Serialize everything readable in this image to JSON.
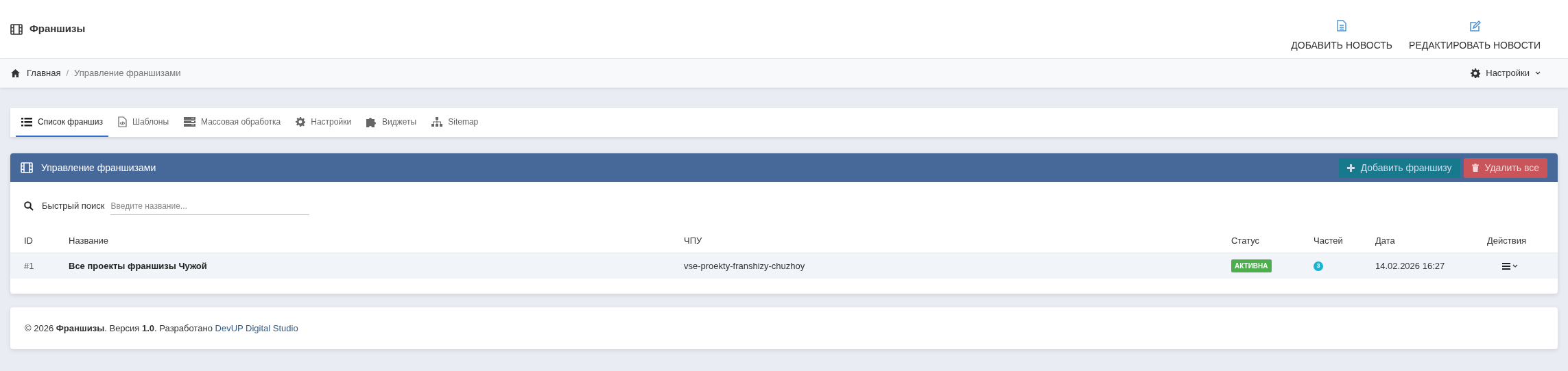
{
  "header": {
    "title": "Франшизы",
    "actions": [
      {
        "label": "ДОБАВИТЬ НОВОСТЬ",
        "kind": "add"
      },
      {
        "label": "РЕДАКТИРОВАТЬ НОВОСТИ",
        "kind": "edit"
      }
    ]
  },
  "breadcrumb": {
    "items": [
      "Главная",
      "Управление франшизами"
    ],
    "separator": "/",
    "settings": "Настройки"
  },
  "tabs": [
    {
      "label": "Список франшиз",
      "kind": "list",
      "selected": true
    },
    {
      "label": "Шаблоны",
      "kind": "template",
      "selected": false
    },
    {
      "label": "Массовая обработка",
      "kind": "mass",
      "selected": false
    },
    {
      "label": "Настройки",
      "kind": "gear",
      "selected": false
    },
    {
      "label": "Виджеты",
      "kind": "puzzle",
      "selected": false
    },
    {
      "label": "Sitemap",
      "kind": "sitemap",
      "selected": false
    }
  ],
  "panel": {
    "title": "Управление франшизами",
    "buttons": [
      {
        "label": "Добавить франшизу",
        "kind": "add"
      },
      {
        "label": "Удалить все",
        "kind": "delete"
      }
    ],
    "search": {
      "label": "Быстрый поиск",
      "placeholder": "Введите название..."
    },
    "table": {
      "columns": [
        "ID",
        "Название",
        "ЧПУ",
        "Статус",
        "Частей",
        "Дата",
        "Действия"
      ],
      "rows": [
        {
          "id": "#1",
          "name": "Все проекты франшизы Чужой",
          "slug": "vse-proekty-franshizy-chuzhoy",
          "status": "АКТИВНА",
          "active": true,
          "parts": "3",
          "date": "14.02.2026 16:27"
        }
      ]
    }
  },
  "footer": {
    "text": "© 2026 **Франшизы**. Версия **1.0**. Разработано ",
    "link": "DevUP Digital Studio"
  }
}
